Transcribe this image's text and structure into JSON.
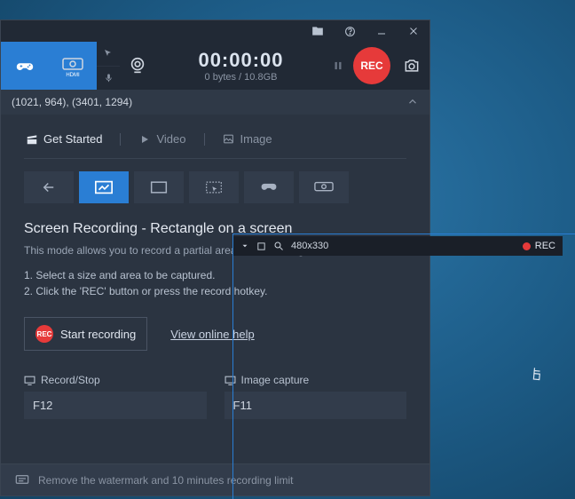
{
  "titlebar": {},
  "topbar": {
    "time": "00:00:00",
    "bytes": "0 bytes / 10.8GB",
    "rec_label": "REC"
  },
  "coords": "(1021, 964), (3401, 1294)",
  "tabs": {
    "get_started": "Get Started",
    "video": "Video",
    "image": "Image"
  },
  "section": {
    "title": "Screen Recording - Rectangle on a screen",
    "desc": "This mode allows you to record a partial area in the rectangle window."
  },
  "instructions": {
    "line1": "1. Select a size and area to be captured.",
    "line2": "2. Click the 'REC' button or press the record hotkey."
  },
  "actions": {
    "start_mini": "REC",
    "start_label": "Start recording",
    "help_label": "View online help"
  },
  "hotkeys": {
    "record_label": "Record/Stop",
    "record_value": "F12",
    "image_label": "Image capture",
    "image_value": "F11"
  },
  "footer": {
    "text": "Remove the watermark and 10 minutes recording limit"
  },
  "selection": {
    "size": "480x330",
    "rec": "REC"
  }
}
